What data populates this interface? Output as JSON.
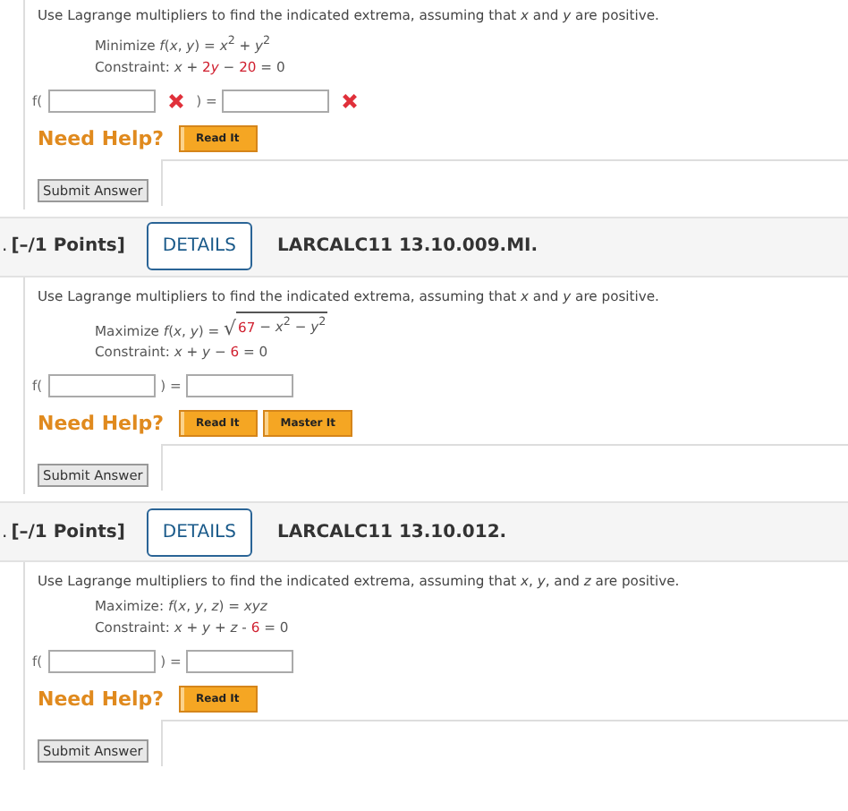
{
  "problems": [
    {
      "instruction": "Use Lagrange multipliers to find the indicated extrema, assuming that *x* and *y* are positive.",
      "lines": [
        [
          {
            "kind": "text",
            "text": "Minimize *f*(*x*, *y*) = *x*$^{2}$ + *y*$^{2}$"
          }
        ],
        [
          {
            "kind": "text",
            "text": "Constraint: *x* + "
          },
          {
            "kind": "given",
            "text": "2"
          },
          {
            "kind": "given",
            "text": "*y*"
          },
          {
            "kind": "text",
            "text": " − "
          },
          {
            "kind": "given",
            "text": "20"
          },
          {
            "kind": "text",
            "text": " = 0"
          }
        ]
      ],
      "answer": {
        "prefix": "f(",
        "middle": ") =",
        "fields": [
          {
            "incorrect": true
          },
          {
            "incorrect": true
          }
        ]
      },
      "help_label": "Need Help?",
      "help_buttons": [
        "Read It"
      ],
      "submit": "Submit Answer"
    },
    {
      "header": {
        "number": ".",
        "points": "[–/1 Points]",
        "details": "DETAILS",
        "code": "LARCALC11 13.10.009.MI."
      },
      "instruction": "Use Lagrange multipliers to find the indicated extrema, assuming that *x* and *y* are positive.",
      "lines": [
        [
          {
            "kind": "text",
            "text": "Maximize *f*(*x*, *y*) = "
          },
          {
            "kind": "root",
            "sign": "√",
            "parts": [
              {
                "kind": "given",
                "text": "67"
              },
              {
                "kind": "text",
                "text": " − *x*$^{2}$ − *y*$^{2}$"
              }
            ]
          }
        ],
        [
          {
            "kind": "text",
            "text": "Constraint: *x* + *y* − "
          },
          {
            "kind": "given",
            "text": "6"
          },
          {
            "kind": "text",
            "text": " = 0"
          }
        ]
      ],
      "answer": {
        "prefix": "f(",
        "middle": ") =",
        "fields": [
          {
            "incorrect": false
          },
          {
            "incorrect": false
          }
        ]
      },
      "help_label": "Need Help?",
      "help_buttons": [
        "Read It",
        "Master It"
      ],
      "submit": "Submit Answer"
    },
    {
      "header": {
        "number": ".",
        "points": "[–/1 Points]",
        "details": "DETAILS",
        "code": "LARCALC11 13.10.012."
      },
      "instruction": "Use Lagrange multipliers to find the indicated extrema, assuming that *x*, *y*, and *z* are positive.",
      "lines": [
        [
          {
            "kind": "text",
            "text": "Maximize: *f*(*x*, *y*, *z*) = *xyz*"
          }
        ],
        [
          {
            "kind": "text",
            "text": "Constraint: *x* + *y* + *z* - "
          },
          {
            "kind": "given",
            "text": "6"
          },
          {
            "kind": "text",
            "text": " = 0"
          }
        ]
      ],
      "answer": {
        "prefix": "f(",
        "middle": ") =",
        "fields": [
          {
            "incorrect": false
          },
          {
            "incorrect": false
          }
        ]
      },
      "help_label": "Need Help?",
      "help_buttons": [
        "Read It"
      ],
      "submit": "Submit Answer"
    }
  ]
}
